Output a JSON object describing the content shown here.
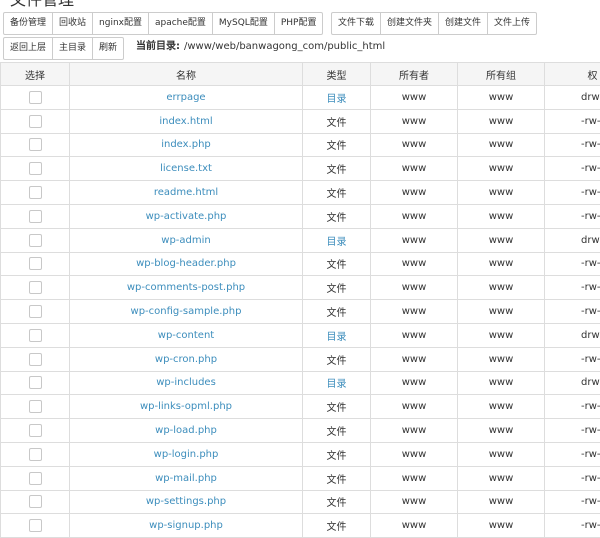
{
  "page": {
    "title": "文件管理"
  },
  "toolbar": {
    "group1": [
      "备份管理",
      "回收站",
      "nginx配置",
      "apache配置",
      "MySQL配置",
      "PHP配置"
    ],
    "group2": [
      "文件下载",
      "创建文件夹",
      "创建文件",
      "文件上传"
    ],
    "nav": [
      "返回上层",
      "主目录",
      "刷新"
    ]
  },
  "path": {
    "label": "当前目录:",
    "value": "/www/web/banwagong_com/public_html"
  },
  "table": {
    "headers": [
      "选择",
      "名称",
      "类型",
      "所有者",
      "所有组",
      "权"
    ],
    "rows": [
      {
        "name": "errpage",
        "type": "目录",
        "owner": "www",
        "group": "www",
        "perm": "drwx"
      },
      {
        "name": "index.html",
        "type": "文件",
        "owner": "www",
        "group": "www",
        "perm": "-rw-"
      },
      {
        "name": "index.php",
        "type": "文件",
        "owner": "www",
        "group": "www",
        "perm": "-rw-"
      },
      {
        "name": "license.txt",
        "type": "文件",
        "owner": "www",
        "group": "www",
        "perm": "-rw-"
      },
      {
        "name": "readme.html",
        "type": "文件",
        "owner": "www",
        "group": "www",
        "perm": "-rw-"
      },
      {
        "name": "wp-activate.php",
        "type": "文件",
        "owner": "www",
        "group": "www",
        "perm": "-rw-"
      },
      {
        "name": "wp-admin",
        "type": "目录",
        "owner": "www",
        "group": "www",
        "perm": "drwx"
      },
      {
        "name": "wp-blog-header.php",
        "type": "文件",
        "owner": "www",
        "group": "www",
        "perm": "-rw-"
      },
      {
        "name": "wp-comments-post.php",
        "type": "文件",
        "owner": "www",
        "group": "www",
        "perm": "-rw-"
      },
      {
        "name": "wp-config-sample.php",
        "type": "文件",
        "owner": "www",
        "group": "www",
        "perm": "-rw-"
      },
      {
        "name": "wp-content",
        "type": "目录",
        "owner": "www",
        "group": "www",
        "perm": "drwx"
      },
      {
        "name": "wp-cron.php",
        "type": "文件",
        "owner": "www",
        "group": "www",
        "perm": "-rw-"
      },
      {
        "name": "wp-includes",
        "type": "目录",
        "owner": "www",
        "group": "www",
        "perm": "drwx"
      },
      {
        "name": "wp-links-opml.php",
        "type": "文件",
        "owner": "www",
        "group": "www",
        "perm": "-rw-"
      },
      {
        "name": "wp-load.php",
        "type": "文件",
        "owner": "www",
        "group": "www",
        "perm": "-rw-"
      },
      {
        "name": "wp-login.php",
        "type": "文件",
        "owner": "www",
        "group": "www",
        "perm": "-rw-"
      },
      {
        "name": "wp-mail.php",
        "type": "文件",
        "owner": "www",
        "group": "www",
        "perm": "-rw-"
      },
      {
        "name": "wp-settings.php",
        "type": "文件",
        "owner": "www",
        "group": "www",
        "perm": "-rw-"
      },
      {
        "name": "wp-signup.php",
        "type": "文件",
        "owner": "www",
        "group": "www",
        "perm": "-rw-"
      }
    ]
  },
  "colors": {
    "link": "#3c8dbc",
    "header_bg": "#f5f5f5",
    "border": "#dddddd"
  }
}
